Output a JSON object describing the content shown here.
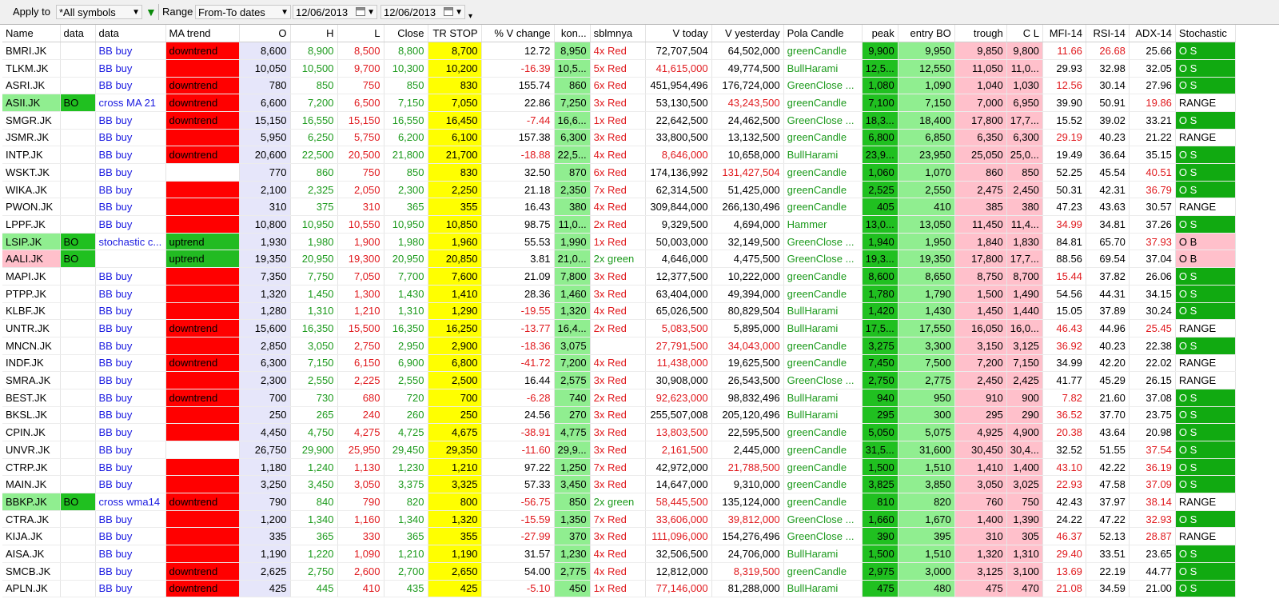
{
  "toolbar": {
    "apply_to_label": "Apply to",
    "apply_to_value": "*All symbols",
    "range_label": "Range",
    "range_value": "From-To dates",
    "from_date": "12/06/2013",
    "to_date": "12/06/2013"
  },
  "columns": [
    "Name",
    "data",
    "data",
    "MA trend",
    "O",
    "H",
    "L",
    "Close",
    "TR STOP",
    "% V change",
    "kon...",
    "sblmnya",
    "V today",
    "V yesterday",
    "Pola Candle",
    "peak",
    "entry BO",
    "trough",
    "C L",
    "MFI-14",
    "RSI-14",
    "ADX-14",
    "Stochastic"
  ],
  "colors": {
    "red": "#ff0000",
    "green": "#22bb22",
    "light_green": "#90ee90",
    "pink": "#ffc0cb",
    "yellow": "#ffff00",
    "lavender": "#e6e6fa"
  },
  "rows": [
    [
      "BMRI.JK",
      "",
      "BB buy",
      "downtrend",
      "8,600",
      "8,900",
      "8,500",
      "8,800",
      "8,700",
      "12.72",
      "8,950",
      "4x Red",
      "72,707,504",
      "64,502,000",
      "greenCandle",
      "9,900",
      "9,950",
      "9,850",
      "9,800",
      "11.66",
      "26.68",
      "25.66",
      "O S"
    ],
    [
      "TLKM.JK",
      "",
      "BB buy",
      "",
      "10,050",
      "10,500",
      "9,700",
      "10,300",
      "10,200",
      "-16.39",
      "10,5...",
      "5x Red",
      "41,615,000",
      "49,774,500",
      "BullHarami",
      "12,5...",
      "12,550",
      "11,050",
      "11,0...",
      "29.93",
      "32.98",
      "32.05",
      "O S"
    ],
    [
      "ASRI.JK",
      "",
      "BB buy",
      "downtrend",
      "780",
      "850",
      "750",
      "850",
      "830",
      "155.74",
      "860",
      "6x Red",
      "451,954,496",
      "176,724,000",
      "GreenClose ...",
      "1,080",
      "1,090",
      "1,040",
      "1,030",
      "12.56",
      "30.14",
      "27.96",
      "O S"
    ],
    [
      "ASII.JK",
      "BO",
      "cross MA 21",
      "downtrend",
      "6,600",
      "7,200",
      "6,500",
      "7,150",
      "7,050",
      "22.86",
      "7,250",
      "3x Red",
      "53,130,500",
      "43,243,500",
      "greenCandle",
      "7,100",
      "7,150",
      "7,000",
      "6,950",
      "39.90",
      "50.91",
      "19.86",
      "RANGE"
    ],
    [
      "SMGR.JK",
      "",
      "BB buy",
      "downtrend",
      "15,150",
      "16,550",
      "15,150",
      "16,550",
      "16,450",
      "-7.44",
      "16,6...",
      "1x Red",
      "22,642,500",
      "24,462,500",
      "GreenClose ...",
      "18,3...",
      "18,400",
      "17,800",
      "17,7...",
      "15.52",
      "39.02",
      "33.21",
      "O S"
    ],
    [
      "JSMR.JK",
      "",
      "BB buy",
      "",
      "5,950",
      "6,250",
      "5,750",
      "6,200",
      "6,100",
      "157.38",
      "6,300",
      "3x Red",
      "33,800,500",
      "13,132,500",
      "greenCandle",
      "6,800",
      "6,850",
      "6,350",
      "6,300",
      "29.19",
      "40.23",
      "21.22",
      "RANGE"
    ],
    [
      "INTP.JK",
      "",
      "BB buy",
      "downtrend",
      "20,600",
      "22,500",
      "20,500",
      "21,800",
      "21,700",
      "-18.88",
      "22,5...",
      "4x Red",
      "8,646,000",
      "10,658,000",
      "BullHarami",
      "23,9...",
      "23,950",
      "25,050",
      "25,0...",
      "19.49",
      "36.64",
      "35.15",
      "O S"
    ],
    [
      "WSKT.JK",
      "",
      "BB buy",
      "",
      "770",
      "860",
      "750",
      "850",
      "830",
      "32.50",
      "870",
      "6x Red",
      "174,136,992",
      "131,427,504",
      "greenCandle",
      "1,060",
      "1,070",
      "860",
      "850",
      "52.25",
      "45.54",
      "40.51",
      "O S"
    ],
    [
      "WIKA.JK",
      "",
      "BB buy",
      "",
      "2,100",
      "2,325",
      "2,050",
      "2,300",
      "2,250",
      "21.18",
      "2,350",
      "7x Red",
      "62,314,500",
      "51,425,000",
      "greenCandle",
      "2,525",
      "2,550",
      "2,475",
      "2,450",
      "50.31",
      "42.31",
      "36.79",
      "O S"
    ],
    [
      "PWON.JK",
      "",
      "BB buy",
      "",
      "310",
      "375",
      "310",
      "365",
      "355",
      "16.43",
      "380",
      "4x Red",
      "309,844,000",
      "266,130,496",
      "greenCandle",
      "405",
      "410",
      "385",
      "380",
      "47.23",
      "43.63",
      "30.57",
      "RANGE"
    ],
    [
      "LPPF.JK",
      "",
      "BB buy",
      "",
      "10,800",
      "10,950",
      "10,550",
      "10,950",
      "10,850",
      "98.75",
      "11,0...",
      "2x Red",
      "9,329,500",
      "4,694,000",
      "Hammer",
      "13,0...",
      "13,050",
      "11,450",
      "11,4...",
      "34.99",
      "34.81",
      "37.26",
      "O S"
    ],
    [
      "LSIP.JK",
      "BO",
      "stochastic c...",
      "uptrend",
      "1,930",
      "1,980",
      "1,900",
      "1,980",
      "1,960",
      "55.53",
      "1,990",
      "1x Red",
      "50,003,000",
      "32,149,500",
      "GreenClose ...",
      "1,940",
      "1,950",
      "1,840",
      "1,830",
      "84.81",
      "65.70",
      "37.93",
      "O B"
    ],
    [
      "AALI.JK",
      "BO",
      "",
      "uptrend",
      "19,350",
      "20,950",
      "19,300",
      "20,950",
      "20,850",
      "3.81",
      "21,0...",
      "2x green",
      "4,646,000",
      "4,475,500",
      "GreenClose ...",
      "19,3...",
      "19,350",
      "17,800",
      "17,7...",
      "88.56",
      "69.54",
      "37.04",
      "O B"
    ],
    [
      "MAPI.JK",
      "",
      "BB buy",
      "",
      "7,350",
      "7,750",
      "7,050",
      "7,700",
      "7,600",
      "21.09",
      "7,800",
      "3x Red",
      "12,377,500",
      "10,222,000",
      "greenCandle",
      "8,600",
      "8,650",
      "8,750",
      "8,700",
      "15.44",
      "37.82",
      "26.06",
      "O S"
    ],
    [
      "PTPP.JK",
      "",
      "BB buy",
      "",
      "1,320",
      "1,450",
      "1,300",
      "1,430",
      "1,410",
      "28.36",
      "1,460",
      "3x Red",
      "63,404,000",
      "49,394,000",
      "greenCandle",
      "1,780",
      "1,790",
      "1,500",
      "1,490",
      "54.56",
      "44.31",
      "34.15",
      "O S"
    ],
    [
      "KLBF.JK",
      "",
      "BB buy",
      "",
      "1,280",
      "1,310",
      "1,210",
      "1,310",
      "1,290",
      "-19.55",
      "1,320",
      "4x Red",
      "65,026,500",
      "80,829,504",
      "BullHarami",
      "1,420",
      "1,430",
      "1,450",
      "1,440",
      "15.05",
      "37.89",
      "30.24",
      "O S"
    ],
    [
      "UNTR.JK",
      "",
      "BB buy",
      "downtrend",
      "15,600",
      "16,350",
      "15,500",
      "16,350",
      "16,250",
      "-13.77",
      "16,4...",
      "2x Red",
      "5,083,500",
      "5,895,000",
      "BullHarami",
      "17,5...",
      "17,550",
      "16,050",
      "16,0...",
      "46.43",
      "44.96",
      "25.45",
      "RANGE"
    ],
    [
      "MNCN.JK",
      "",
      "BB buy",
      "",
      "2,850",
      "3,050",
      "2,750",
      "2,950",
      "2,900",
      "-18.36",
      "3,075",
      "",
      "27,791,500",
      "34,043,000",
      "greenCandle",
      "3,275",
      "3,300",
      "3,150",
      "3,125",
      "36.92",
      "40.23",
      "22.38",
      "O S"
    ],
    [
      "INDF.JK",
      "",
      "BB buy",
      "downtrend",
      "6,300",
      "7,150",
      "6,150",
      "6,900",
      "6,800",
      "-41.72",
      "7,200",
      "4x Red",
      "11,438,000",
      "19,625,500",
      "greenCandle",
      "7,450",
      "7,500",
      "7,200",
      "7,150",
      "34.99",
      "42.20",
      "22.02",
      "RANGE"
    ],
    [
      "SMRA.JK",
      "",
      "BB buy",
      "",
      "2,300",
      "2,550",
      "2,225",
      "2,550",
      "2,500",
      "16.44",
      "2,575",
      "3x Red",
      "30,908,000",
      "26,543,500",
      "GreenClose ...",
      "2,750",
      "2,775",
      "2,450",
      "2,425",
      "41.77",
      "45.29",
      "26.15",
      "RANGE"
    ],
    [
      "BEST.JK",
      "",
      "BB buy",
      "downtrend",
      "700",
      "730",
      "680",
      "720",
      "700",
      "-6.28",
      "740",
      "2x Red",
      "92,623,000",
      "98,832,496",
      "BullHarami",
      "940",
      "950",
      "910",
      "900",
      "7.82",
      "21.60",
      "37.08",
      "O S"
    ],
    [
      "BKSL.JK",
      "",
      "BB buy",
      "",
      "250",
      "265",
      "240",
      "260",
      "250",
      "24.56",
      "270",
      "3x Red",
      "255,507,008",
      "205,120,496",
      "BullHarami",
      "295",
      "300",
      "295",
      "290",
      "36.52",
      "37.70",
      "23.75",
      "O S"
    ],
    [
      "CPIN.JK",
      "",
      "BB buy",
      "",
      "4,450",
      "4,750",
      "4,275",
      "4,725",
      "4,675",
      "-38.91",
      "4,775",
      "3x Red",
      "13,803,500",
      "22,595,500",
      "greenCandle",
      "5,050",
      "5,075",
      "4,925",
      "4,900",
      "20.38",
      "43.64",
      "20.98",
      "O S"
    ],
    [
      "UNVR.JK",
      "",
      "BB buy",
      "",
      "26,750",
      "29,900",
      "25,950",
      "29,450",
      "29,350",
      "-11.60",
      "29,9...",
      "3x Red",
      "2,161,500",
      "2,445,000",
      "greenCandle",
      "31,5...",
      "31,600",
      "30,450",
      "30,4...",
      "32.52",
      "51.55",
      "37.54",
      "O S"
    ],
    [
      "CTRP.JK",
      "",
      "BB buy",
      "",
      "1,180",
      "1,240",
      "1,130",
      "1,230",
      "1,210",
      "97.22",
      "1,250",
      "7x Red",
      "42,972,000",
      "21,788,500",
      "greenCandle",
      "1,500",
      "1,510",
      "1,410",
      "1,400",
      "43.10",
      "42.22",
      "36.19",
      "O S"
    ],
    [
      "MAIN.JK",
      "",
      "BB buy",
      "",
      "3,250",
      "3,450",
      "3,050",
      "3,375",
      "3,325",
      "57.33",
      "3,450",
      "3x Red",
      "14,647,000",
      "9,310,000",
      "greenCandle",
      "3,825",
      "3,850",
      "3,050",
      "3,025",
      "22.93",
      "47.58",
      "37.09",
      "O S"
    ],
    [
      "BBKP.JK",
      "BO",
      "cross wma14",
      "downtrend",
      "790",
      "840",
      "790",
      "820",
      "800",
      "-56.75",
      "850",
      "2x green",
      "58,445,500",
      "135,124,000",
      "greenCandle",
      "810",
      "820",
      "760",
      "750",
      "42.43",
      "37.97",
      "38.14",
      "RANGE"
    ],
    [
      "CTRA.JK",
      "",
      "BB buy",
      "",
      "1,200",
      "1,340",
      "1,160",
      "1,340",
      "1,320",
      "-15.59",
      "1,350",
      "7x Red",
      "33,606,000",
      "39,812,000",
      "GreenClose ...",
      "1,660",
      "1,670",
      "1,400",
      "1,390",
      "24.22",
      "47.22",
      "32.93",
      "O S"
    ],
    [
      "KIJA.JK",
      "",
      "BB buy",
      "",
      "335",
      "365",
      "330",
      "365",
      "355",
      "-27.99",
      "370",
      "3x Red",
      "111,096,000",
      "154,276,496",
      "GreenClose ...",
      "390",
      "395",
      "310",
      "305",
      "46.37",
      "52.13",
      "28.87",
      "RANGE"
    ],
    [
      "AISA.JK",
      "",
      "BB buy",
      "",
      "1,190",
      "1,220",
      "1,090",
      "1,210",
      "1,190",
      "31.57",
      "1,230",
      "4x Red",
      "32,506,500",
      "24,706,000",
      "BullHarami",
      "1,500",
      "1,510",
      "1,320",
      "1,310",
      "29.40",
      "33.51",
      "23.65",
      "O S"
    ],
    [
      "SMCB.JK",
      "",
      "BB buy",
      "downtrend",
      "2,625",
      "2,750",
      "2,600",
      "2,700",
      "2,650",
      "54.00",
      "2,775",
      "4x Red",
      "12,812,000",
      "8,319,500",
      "greenCandle",
      "2,975",
      "3,000",
      "3,125",
      "3,100",
      "13.69",
      "22.19",
      "44.77",
      "O S"
    ],
    [
      "APLN.JK",
      "",
      "BB buy",
      "downtrend",
      "425",
      "445",
      "410",
      "435",
      "425",
      "-5.10",
      "450",
      "1x Red",
      "77,146,000",
      "81,288,000",
      "BullHarami",
      "475",
      "480",
      "475",
      "470",
      "21.08",
      "34.59",
      "21.00",
      "O S"
    ]
  ]
}
